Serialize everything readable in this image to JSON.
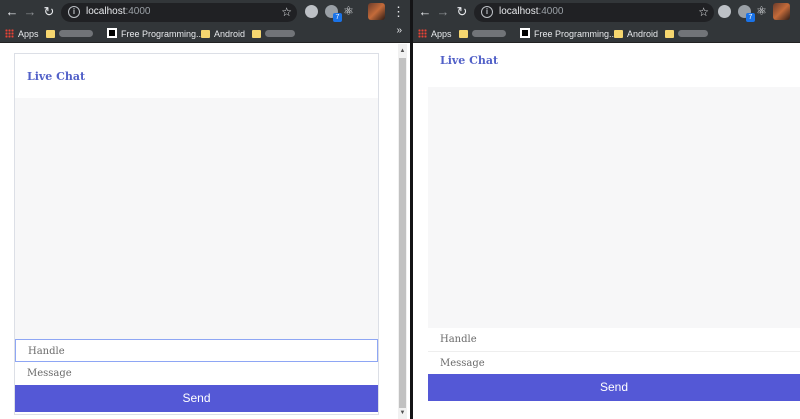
{
  "left_browser": {
    "url": "localhost",
    "port": ":4000",
    "bookmarks": [
      "Apps",
      "Free Programming...",
      "Android"
    ],
    "more": "»"
  },
  "right_browser": {
    "url": "localhost",
    "port": ":4000",
    "bookmarks": [
      "Apps",
      "Free Programming...",
      "Android"
    ]
  },
  "chat": {
    "title": "Live Chat",
    "handle_placeholder": "Handle",
    "message_placeholder": "Message",
    "send_label": "Send"
  },
  "colors": {
    "accent": "#5458d6",
    "title": "#5160c8",
    "chrome": "#323639"
  }
}
